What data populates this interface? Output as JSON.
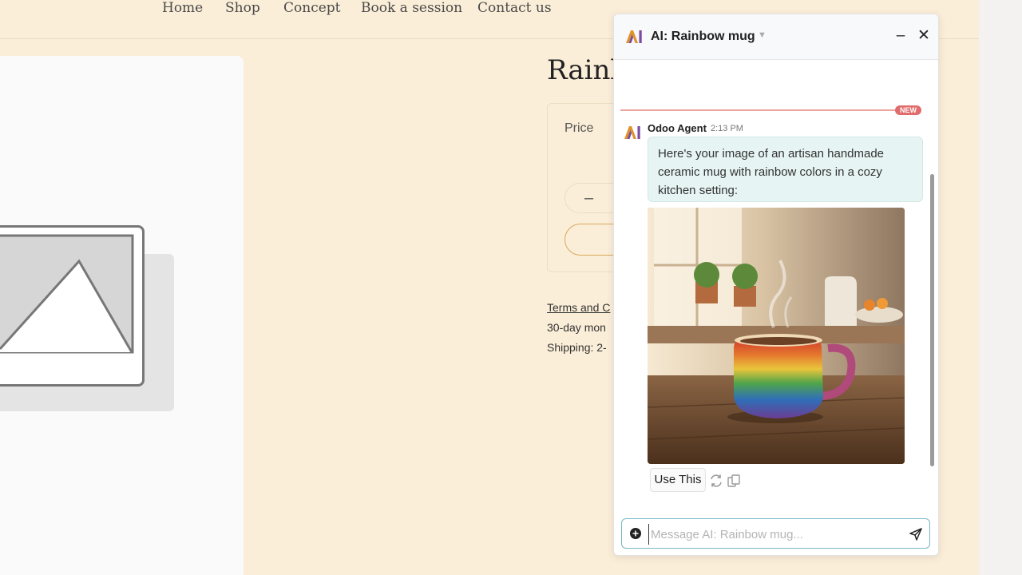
{
  "nav": {
    "items": [
      "Home",
      "Shop",
      "Concept",
      "Book a session",
      "Contact us"
    ]
  },
  "product": {
    "title": "Rainb",
    "price_label": "Price",
    "qty_minus": "–",
    "terms": "Terms and C",
    "guarantee": "30-day mon",
    "shipping": "Shipping: 2-"
  },
  "chat": {
    "title": "AI: Rainbow mug",
    "new_badge": "NEW",
    "author": "Odoo Agent",
    "time": "2:13 PM",
    "message": "Here's your image of an artisan handmade ceramic mug with rainbow colors in a cozy kitchen setting:",
    "use_this": "Use This",
    "input_placeholder": "Message AI: Rainbow mug...",
    "icons": {
      "minimize": "minimize-icon",
      "close": "close-icon",
      "regenerate": "refresh-icon",
      "copy": "copy-icon",
      "attach": "plus-circle-icon",
      "send": "send-icon"
    }
  },
  "colors": {
    "page_bg": "#fbeed8",
    "chat_bubble": "#e6f4f3",
    "new_badge": "#e06c6c",
    "add_to_cart_border": "#d8a85a",
    "composer_border": "#77b8c6"
  }
}
